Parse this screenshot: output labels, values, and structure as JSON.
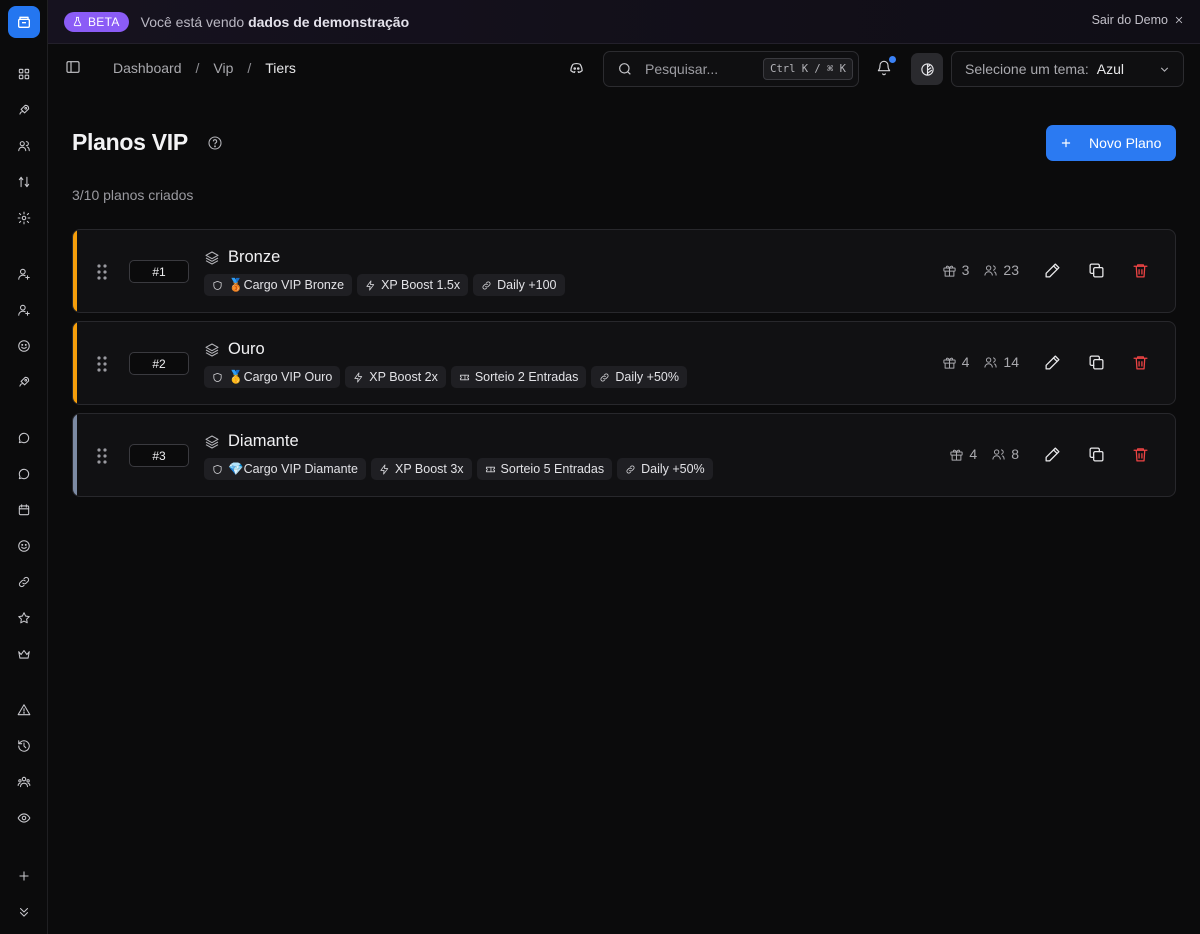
{
  "colors": {
    "accent": "#2b7af2",
    "beta": "#8b5cf6",
    "danger": "#ef4444",
    "bronze": "#f59e0b",
    "gold": "#f59e0b",
    "diamond": "#7c8aa3"
  },
  "banner": {
    "badge": "BETA",
    "text_prefix": "Você está vendo",
    "text_bold": "dados de demonstração",
    "exit": "Sair do Demo"
  },
  "sidebar": {
    "icons": [
      "dashboard-icon",
      "rocket-icon",
      "users-icon",
      "sort-icon",
      "settings-icon",
      "user-plus-icon",
      "user-plus-icon",
      "smile-icon",
      "rocket-icon",
      "message-icon",
      "message-icon",
      "calendar-icon",
      "smile-icon",
      "link-icon",
      "star-icon",
      "crown-icon",
      "alert-icon",
      "history-icon",
      "team-icon",
      "eye-icon",
      "plus-icon",
      "chevrons-down-icon"
    ]
  },
  "topbar": {
    "breadcrumb": [
      "Dashboard",
      "Vip",
      "Tiers"
    ],
    "separator": "/",
    "search_placeholder": "Pesquisar...",
    "search_shortcut": "Ctrl K / ⌘ K",
    "theme_label": "Selecione um tema:",
    "theme_value": "Azul"
  },
  "page": {
    "title": "Planos VIP",
    "subtitle": "3/10 planos criados",
    "new_button": "Novo Plano"
  },
  "tiers": [
    {
      "rank": "#1",
      "name": "Bronze",
      "accent": "#f59e0b",
      "tags": [
        {
          "icon": "shield-icon",
          "label": "🥉Cargo VIP Bronze"
        },
        {
          "icon": "zap-icon",
          "label": "XP Boost 1.5x"
        },
        {
          "icon": "link-icon",
          "label": "Daily +100"
        }
      ],
      "rewards": "3",
      "members": "23"
    },
    {
      "rank": "#2",
      "name": "Ouro",
      "accent": "#f59e0b",
      "tags": [
        {
          "icon": "shield-icon",
          "label": "🥇Cargo VIP Ouro"
        },
        {
          "icon": "zap-icon",
          "label": "XP Boost 2x"
        },
        {
          "icon": "ticket-icon",
          "label": "Sorteio 2 Entradas"
        },
        {
          "icon": "link-icon",
          "label": "Daily +50%"
        }
      ],
      "rewards": "4",
      "members": "14"
    },
    {
      "rank": "#3",
      "name": "Diamante",
      "accent": "#7c8aa3",
      "tags": [
        {
          "icon": "shield-icon",
          "label": "💎Cargo VIP Diamante"
        },
        {
          "icon": "zap-icon",
          "label": "XP Boost 3x"
        },
        {
          "icon": "ticket-icon",
          "label": "Sorteio 5 Entradas"
        },
        {
          "icon": "link-icon",
          "label": "Daily +50%"
        }
      ],
      "rewards": "4",
      "members": "8"
    }
  ]
}
